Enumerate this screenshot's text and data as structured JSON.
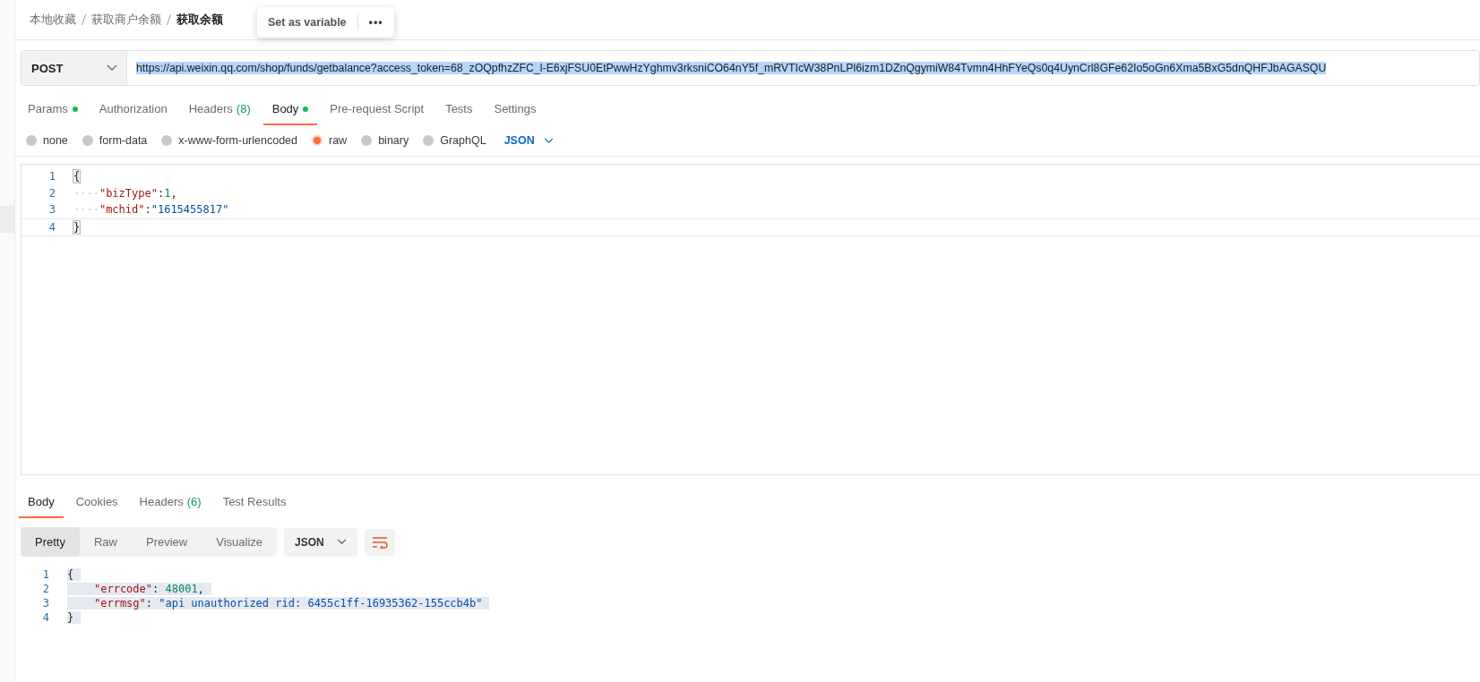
{
  "breadcrumb": [
    "本地收藏",
    "获取商户余额",
    "获取余额"
  ],
  "popup": {
    "action": "Set as variable",
    "more": "•••"
  },
  "request": {
    "method": "POST",
    "url": "https://api.weixin.qq.com/shop/funds/getbalance?access_token=68_zOQpfhzZFC_l-E6xjFSU0EtPwwHzYghmv3rksniCO64nY5f_mRVTIcW38PnLPl6izm1DZnQgymiW84Tvmn4HhFYeQs0q4UynCrl8GFe62Io5oGn6Xma5BxG5dnQHFJbAGASQU",
    "url_selected": true
  },
  "tabs": [
    {
      "label": "Params",
      "dot": true,
      "selected": false
    },
    {
      "label": "Authorization",
      "selected": false
    },
    {
      "label": "Headers",
      "count": "(8)",
      "selected": false
    },
    {
      "label": "Body",
      "dot": true,
      "selected": true
    },
    {
      "label": "Pre-request Script",
      "selected": false
    },
    {
      "label": "Tests",
      "selected": false
    },
    {
      "label": "Settings",
      "selected": false
    }
  ],
  "body_types": [
    {
      "label": "none",
      "selected": false
    },
    {
      "label": "form-data",
      "selected": false
    },
    {
      "label": "x-www-form-urlencoded",
      "selected": false
    },
    {
      "label": "raw",
      "selected": true
    },
    {
      "label": "binary",
      "selected": false
    },
    {
      "label": "GraphQL",
      "selected": false
    }
  ],
  "body_format": "JSON",
  "request_body": [
    {
      "number": "1",
      "tokens": [
        {
          "kind": "brace",
          "text": "{"
        }
      ]
    },
    {
      "number": "2",
      "tokens": [
        {
          "kind": "ws",
          "text": "····"
        },
        {
          "kind": "key",
          "text": "\"bizType\""
        },
        {
          "kind": "punct",
          "text": ":"
        },
        {
          "kind": "num",
          "text": "1"
        },
        {
          "kind": "punct",
          "text": ","
        }
      ]
    },
    {
      "number": "3",
      "tokens": [
        {
          "kind": "ws",
          "text": "····"
        },
        {
          "kind": "key",
          "text": "\"mchid\""
        },
        {
          "kind": "punct",
          "text": ":"
        },
        {
          "kind": "str",
          "text": "\"1615455817\""
        }
      ]
    },
    {
      "number": "4",
      "tokens": [
        {
          "kind": "brace",
          "text": "}"
        }
      ]
    }
  ],
  "response_tabs": [
    {
      "label": "Body",
      "selected": true
    },
    {
      "label": "Cookies",
      "selected": false
    },
    {
      "label": "Headers",
      "count": "(6)",
      "selected": false
    },
    {
      "label": "Test Results",
      "selected": false
    }
  ],
  "views": [
    {
      "label": "Pretty",
      "selected": true
    },
    {
      "label": "Raw",
      "selected": false
    },
    {
      "label": "Preview",
      "selected": false
    },
    {
      "label": "Visualize",
      "selected": false
    }
  ],
  "response_format": "JSON",
  "response_body": [
    {
      "number": "1",
      "tokens": [
        {
          "kind": "punct",
          "text": "{"
        }
      ]
    },
    {
      "number": "2",
      "indent": true,
      "tokens": [
        {
          "kind": "key",
          "text": "\"errcode\""
        },
        {
          "kind": "punct",
          "text": ": "
        },
        {
          "kind": "num",
          "text": "48001"
        },
        {
          "kind": "punct",
          "text": ","
        }
      ]
    },
    {
      "number": "3",
      "indent": true,
      "tokens": [
        {
          "kind": "key",
          "text": "\"errmsg\""
        },
        {
          "kind": "punct",
          "text": ": "
        },
        {
          "kind": "str",
          "text": "\"api unauthorized rid: 6455c1ff-16935362-155ccb4b\""
        }
      ]
    },
    {
      "number": "4",
      "tokens": [
        {
          "kind": "punct",
          "text": "}"
        }
      ]
    }
  ]
}
